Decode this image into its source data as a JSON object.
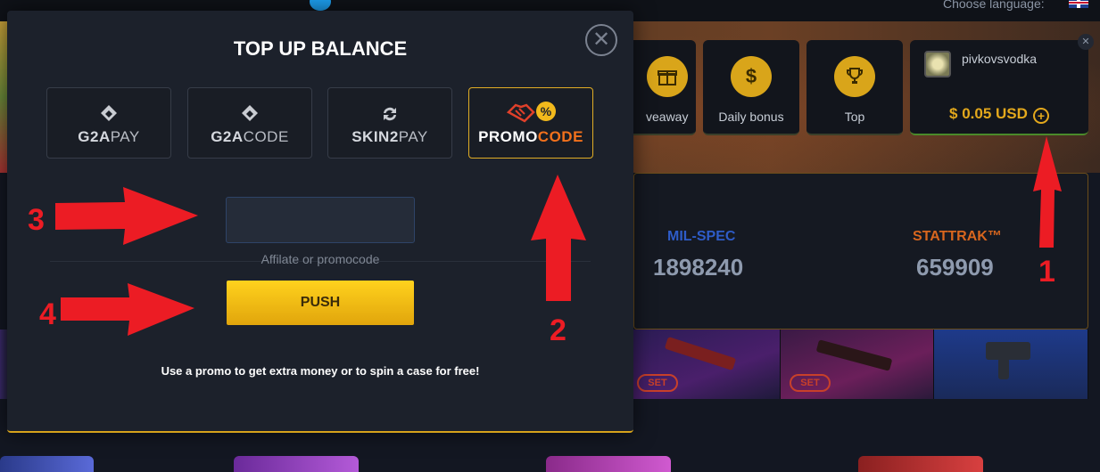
{
  "header": {
    "language_label": "Choose language:"
  },
  "nav": {
    "items": [
      {
        "label": "veaway",
        "icon": "gift-icon"
      },
      {
        "label": "Daily bonus",
        "icon": "dollar-icon"
      },
      {
        "label": "Top",
        "icon": "trophy-icon"
      }
    ]
  },
  "user": {
    "name": "pivkovsvodka",
    "balance": "$ 0.05 USD"
  },
  "stats": [
    {
      "label": "MIL-SPEC",
      "value": "1898240",
      "color": "#2e5cc8"
    },
    {
      "label": "STATTRAK™",
      "value": "659909",
      "color": "#d8661e"
    }
  ],
  "skins": {
    "set_badge": "SET"
  },
  "modal": {
    "title": "TOP UP BALANCE",
    "methods": [
      {
        "bold": "G2A",
        "thin": "PAY",
        "icon": "g2a-icon"
      },
      {
        "bold": "G2A",
        "thin": "CODE",
        "icon": "g2a-icon"
      },
      {
        "bold": "SKIN2",
        "thin": "PAY",
        "icon": "refresh-icon"
      },
      {
        "bold": "PROMO",
        "orange": "CODE",
        "icon": "handshake-percent-icon",
        "active": true
      }
    ],
    "input_value": "",
    "input_hint": "Affilate or promocode",
    "push_label": "PUSH",
    "note": "Use a promo to get extra money or to spin a case for free!"
  },
  "annotations": [
    "1",
    "2",
    "3",
    "4"
  ],
  "colors": {
    "accent": "#e1ad25",
    "annotation": "#ec1c24",
    "modal_bg": "#1c212b"
  }
}
